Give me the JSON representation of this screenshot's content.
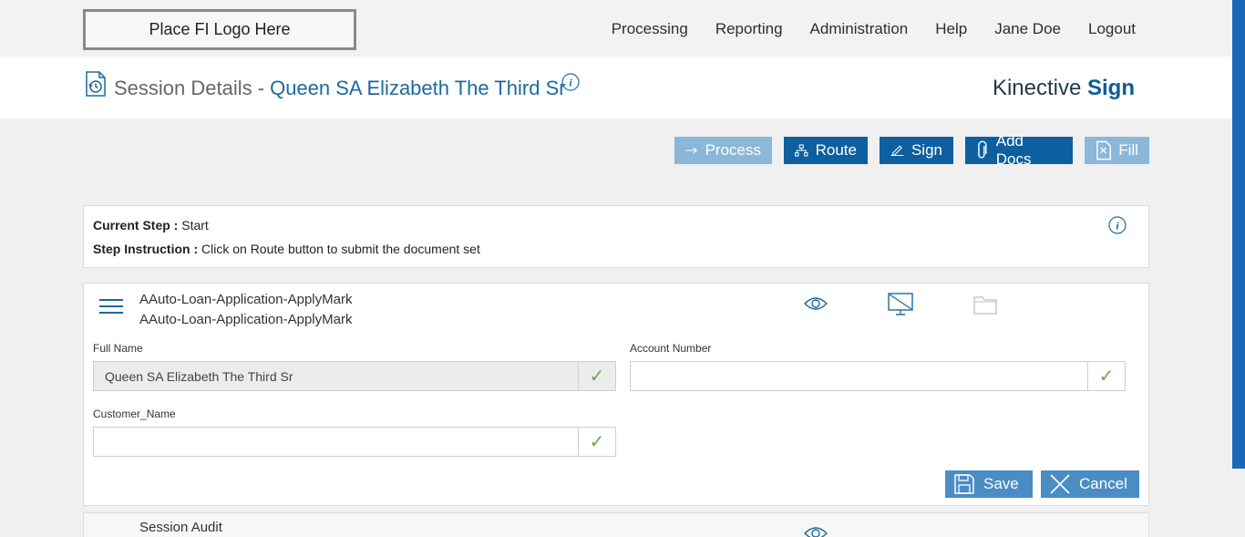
{
  "topbar": {
    "logo_text": "Place FI Logo Here",
    "nav": [
      "Processing",
      "Reporting",
      "Administration",
      "Help",
      "Jane Doe",
      "Logout"
    ]
  },
  "header": {
    "title_prefix": "Session Details -",
    "session_name": "Queen SA Elizabeth The Third Sr",
    "brand_light": "Kinective",
    "brand_bold": "Sign",
    "icons": [
      "history-icon",
      "info-icon"
    ]
  },
  "toolbar": {
    "buttons": [
      {
        "label": "Process",
        "icon": "arrow-right-icon",
        "state": "disabled"
      },
      {
        "label": "Route",
        "icon": "sitemap-icon",
        "state": "enabled"
      },
      {
        "label": "Sign",
        "icon": "pen-icon",
        "state": "enabled"
      },
      {
        "label": "Add Docs",
        "icon": "paperclip-icon",
        "state": "enabled"
      },
      {
        "label": "Fill",
        "icon": "document-x-icon",
        "state": "disabled"
      }
    ]
  },
  "step": {
    "current_step_label": "Current Step :",
    "current_step_value": "Start",
    "instruction_label": "Step Instruction :",
    "instruction_value": "Click on Route button to submit the document set"
  },
  "document": {
    "name_line1": "AAuto-Loan-Application-ApplyMark",
    "name_line2": "AAuto-Loan-Application-ApplyMark",
    "icons": [
      "eye-icon",
      "monitor-off-icon",
      "folder-icon"
    ],
    "fields": [
      {
        "label": "Full Name",
        "value": "Queen SA Elizabeth The Third Sr",
        "readonly": true
      },
      {
        "label": "Account Number",
        "value": "",
        "readonly": false
      },
      {
        "label": "Customer_Name",
        "value": "",
        "readonly": false
      }
    ],
    "check_glyph": "✓",
    "save_label": "Save",
    "cancel_label": "Cancel"
  },
  "audit": {
    "label": "Session Audit"
  },
  "colors": {
    "primary": "#0d5fa0",
    "primary_disabled": "#8ab7da",
    "secondary_button": "#4a8cc4",
    "link": "#1d6a9c",
    "check": "#6aa84f"
  }
}
